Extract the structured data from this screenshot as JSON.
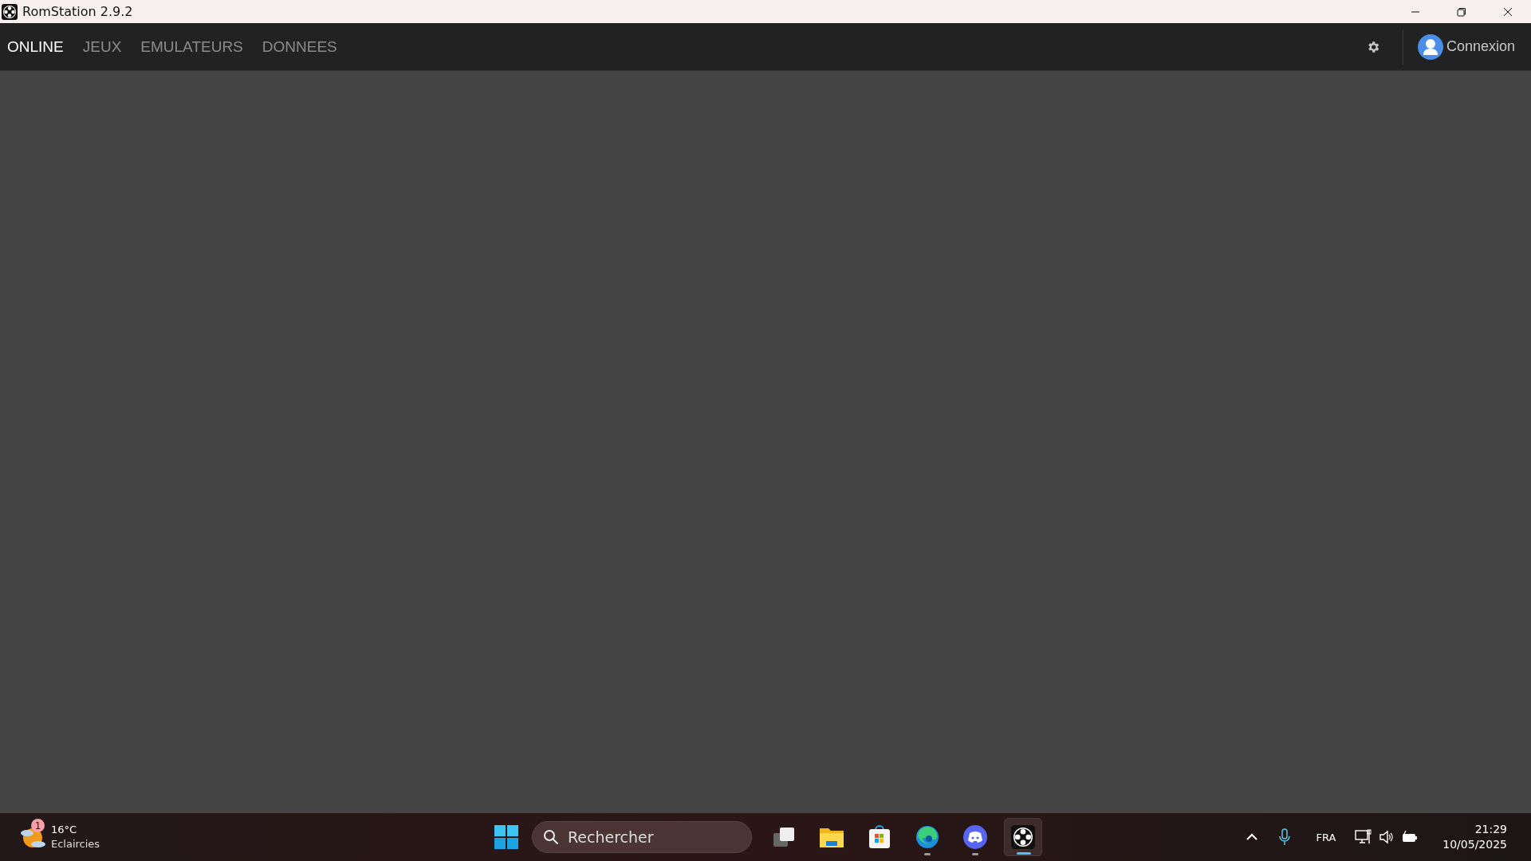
{
  "window": {
    "title": "RomStation 2.9.2"
  },
  "tabs": [
    {
      "label": "ONLINE",
      "selected": true
    },
    {
      "label": "JEUX",
      "selected": false
    },
    {
      "label": "EMULATEURS",
      "selected": false
    },
    {
      "label": "DONNEES",
      "selected": false
    }
  ],
  "account": {
    "label": "Connexion"
  },
  "taskbar": {
    "weather": {
      "temperature": "16°C",
      "condition": "Eclaircies",
      "badge": "1"
    },
    "search": {
      "placeholder": "Rechercher"
    },
    "apps": [
      {
        "kind": "taskview",
        "running": false,
        "selected": false
      },
      {
        "kind": "explorer",
        "running": false,
        "selected": false
      },
      {
        "kind": "store",
        "running": false,
        "selected": false
      },
      {
        "kind": "edge",
        "running": true,
        "selected": false
      },
      {
        "kind": "discord",
        "running": true,
        "selected": false
      },
      {
        "kind": "romstation",
        "running": true,
        "selected": true
      }
    ],
    "tray": {
      "language": "FRA",
      "time": "21:29",
      "date": "10/05/2025"
    }
  }
}
